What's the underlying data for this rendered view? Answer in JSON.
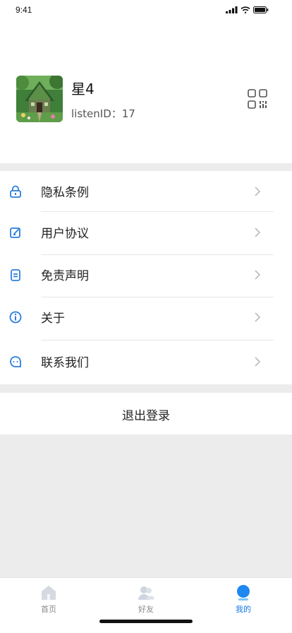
{
  "status_bar": {
    "time": "9:41"
  },
  "profile": {
    "username": "星4",
    "listen_id": "listenID：17"
  },
  "menu": {
    "items": [
      {
        "label": "隐私条例",
        "icon": "lock-icon"
      },
      {
        "label": "用户协议",
        "icon": "edit-icon"
      },
      {
        "label": "免责声明",
        "icon": "document-icon"
      },
      {
        "label": "关于",
        "icon": "info-icon"
      },
      {
        "label": "联系我们",
        "icon": "chat-icon"
      }
    ]
  },
  "logout": {
    "label": "退出登录"
  },
  "tabbar": {
    "tabs": [
      {
        "label": "首页",
        "icon": "home-icon",
        "active": false
      },
      {
        "label": "好友",
        "icon": "friends-icon",
        "active": false
      },
      {
        "label": "我的",
        "icon": "profile-icon",
        "active": true
      }
    ]
  },
  "colors": {
    "accent": "#1677e6",
    "icon_blue": "#2b7fdb",
    "background": "#ececec"
  }
}
